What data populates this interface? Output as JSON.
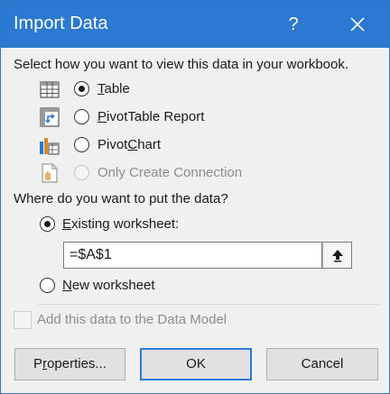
{
  "window": {
    "title": "Import Data",
    "help_label": "?"
  },
  "view_section": {
    "prompt": "Select how you want to view this data in your workbook.",
    "options": [
      {
        "label": "Table",
        "accesskey": "T",
        "rest": "able",
        "selected": true,
        "enabled": true,
        "icon": "table-icon"
      },
      {
        "label": "PivotTable Report",
        "accesskey": "P",
        "rest": "ivotTable Report",
        "selected": false,
        "enabled": true,
        "icon": "pivottable-icon"
      },
      {
        "label": "PivotChart",
        "pre": "Pivot",
        "accesskey": "C",
        "rest": "hart",
        "selected": false,
        "enabled": true,
        "icon": "pivotchart-icon"
      },
      {
        "label": "Only Create Connection",
        "selected": false,
        "enabled": false,
        "icon": "connection-icon"
      }
    ]
  },
  "location_section": {
    "prompt": "Where do you want to put the data?",
    "existing": {
      "pre": "",
      "accesskey": "E",
      "rest": "xisting worksheet:",
      "selected": true
    },
    "reference_value": "=$A$1",
    "new": {
      "accesskey": "N",
      "rest": "ew worksheet",
      "selected": false
    }
  },
  "data_model": {
    "label": "Add this data to the Data Model",
    "checked": false,
    "enabled": false
  },
  "buttons": {
    "properties": {
      "pre": "P",
      "accesskey": "r",
      "rest": "operties..."
    },
    "ok": "OK",
    "cancel": "Cancel"
  }
}
